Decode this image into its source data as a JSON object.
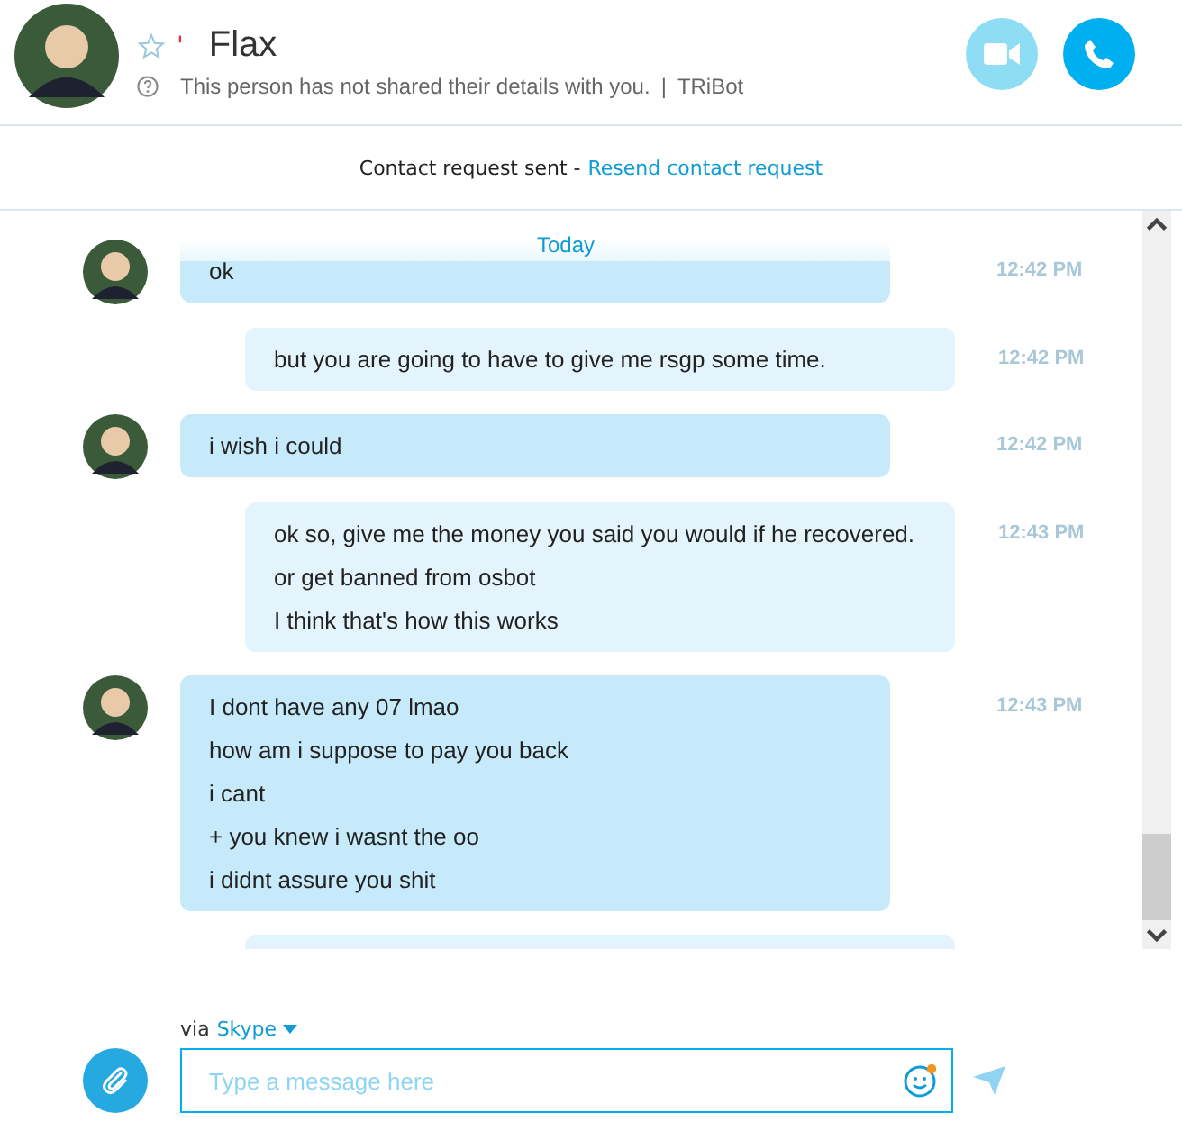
{
  "contact": {
    "name": "Flax",
    "mark": "'",
    "favorite": false,
    "details": "This person has not shared their details with you.",
    "separator": "|",
    "source": "TRiBot"
  },
  "notice": {
    "text": "Contact request sent -",
    "link": "Resend contact request"
  },
  "date_divider": "Today",
  "messages": [
    {
      "kind": "incoming",
      "lines": [
        "ok"
      ],
      "time": "12:42 PM"
    },
    {
      "kind": "outgoing",
      "lines": [
        "but you are going to have to give me rsgp some time."
      ],
      "time": "12:42 PM"
    },
    {
      "kind": "incoming",
      "lines": [
        "i wish i could"
      ],
      "time": "12:42 PM"
    },
    {
      "kind": "outgoing",
      "lines": [
        "ok so, give me the money you said you would if he recovered. or get banned from osbot",
        "I think that's how this works"
      ],
      "time": "12:43 PM"
    },
    {
      "kind": "incoming",
      "lines": [
        "I dont have any 07 lmao",
        "how am i suppose to pay you back",
        "i cant",
        "+ you knew i wasnt the oo",
        "i didnt assure you shit"
      ],
      "time": "12:43 PM"
    },
    {
      "kind": "outgoing"
    }
  ],
  "composer": {
    "via": "via",
    "service": "Skype",
    "placeholder": "Type a message here"
  }
}
